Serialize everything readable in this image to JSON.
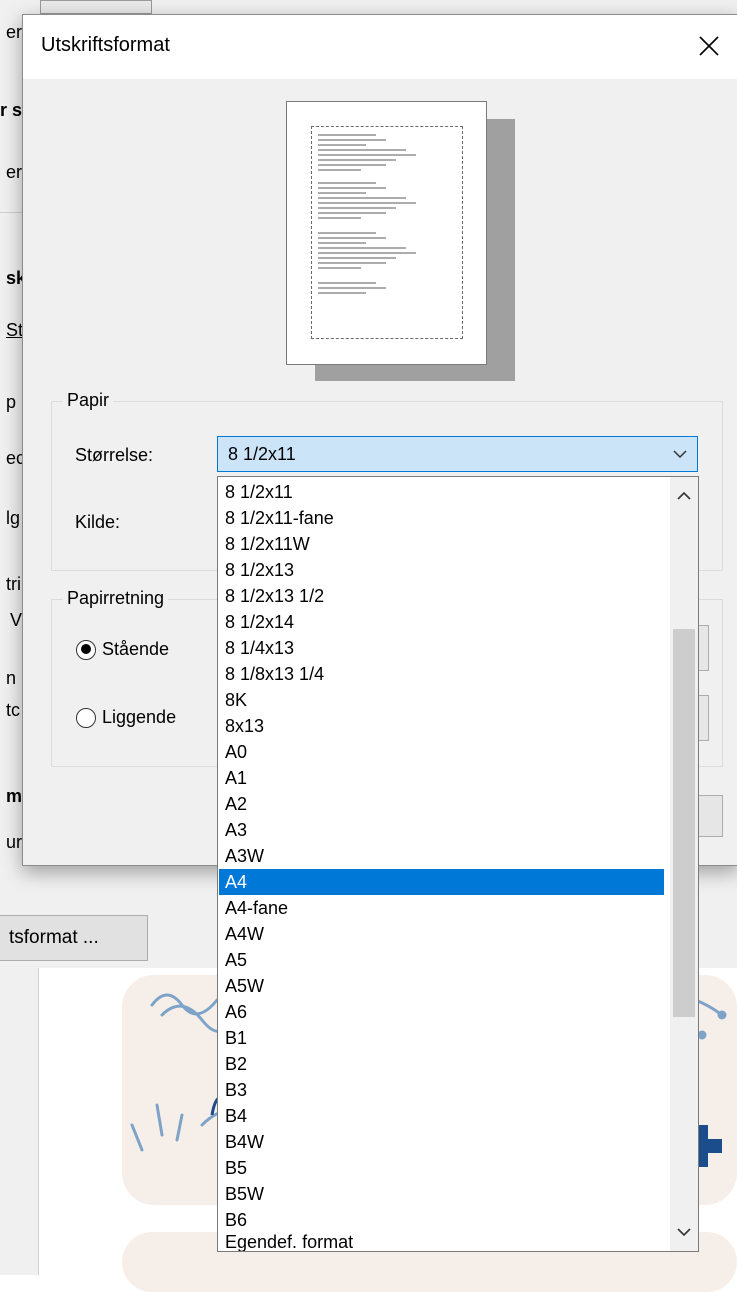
{
  "background": {
    "left_strip_letters": [
      "er",
      "r s",
      "er",
      "sk",
      "St",
      "p",
      "ec",
      "lg",
      "tri",
      "V",
      "n",
      "tc",
      "m",
      "ur"
    ],
    "bottom_button_label": "tsformat ..."
  },
  "dialog": {
    "title": "Utskriftsformat",
    "close_glyph": "✕",
    "paper_group_label": "Papir",
    "size_label": "Størrelse:",
    "source_label": "Kilde:",
    "selected_size": "8 1/2x11",
    "orientation_group_label": "Papirretning",
    "orientation_options": [
      {
        "label": "Stående",
        "checked": true
      },
      {
        "label": "Liggende",
        "checked": false
      }
    ]
  },
  "dropdown": {
    "selected_value": "A4",
    "items": [
      "8 1/2x11",
      "8 1/2x11-fane",
      "8 1/2x11W",
      "8 1/2x13",
      "8 1/2x13 1/2",
      "8 1/2x14",
      "8 1/4x13",
      "8 1/8x13 1/4",
      "8K",
      "8x13",
      "A0",
      "A1",
      "A2",
      "A3",
      "A3W",
      "A4",
      "A4-fane",
      "A4W",
      "A5",
      "A5W",
      "A6",
      "B1",
      "B2",
      "B3",
      "B4",
      "B4W",
      "B5",
      "B5W",
      "B6",
      "Egendef. format"
    ]
  },
  "icons": {
    "close": "close-icon",
    "combo_arrow": "chevron-down-icon",
    "scroll_up": "chevron-up-icon",
    "scroll_down": "chevron-down-icon"
  },
  "colors": {
    "accent": "#0078d7",
    "combo_bg": "#cce4f7",
    "dialog_bg": "#f0f0f0"
  }
}
